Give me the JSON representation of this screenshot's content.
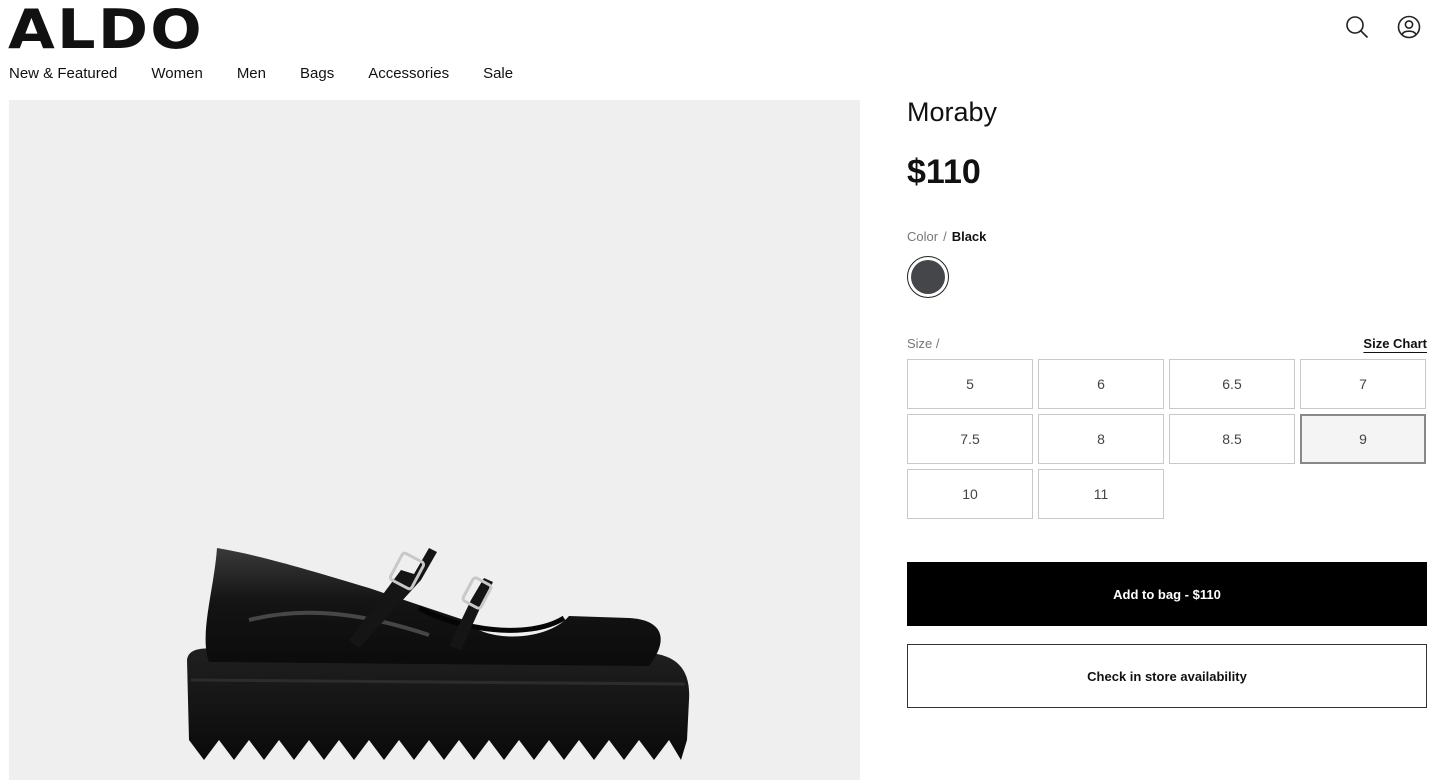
{
  "brand": {
    "logo_text": "ALDO"
  },
  "header": {
    "icons": [
      "search-icon",
      "account-icon"
    ],
    "nav": [
      "New & Featured",
      "Women",
      "Men",
      "Bags",
      "Accessories",
      "Sale"
    ]
  },
  "product": {
    "name": "Moraby",
    "price": "$110",
    "color_label": "Color",
    "color_separator": "/",
    "color_value": "Black",
    "swatch_color": "#444649",
    "size_label": "Size /",
    "size_chart": "Size Chart",
    "sizes": [
      "5",
      "6",
      "6.5",
      "7",
      "7.5",
      "8",
      "8.5",
      "9",
      "10",
      "11"
    ],
    "selected_size": "9",
    "add_to_bag": "Add to bag - $110",
    "check_store": "Check in store availability"
  },
  "colors": {
    "image_bg": "#efefef",
    "primary_button": "#000000",
    "border": "#c9c9c9"
  }
}
